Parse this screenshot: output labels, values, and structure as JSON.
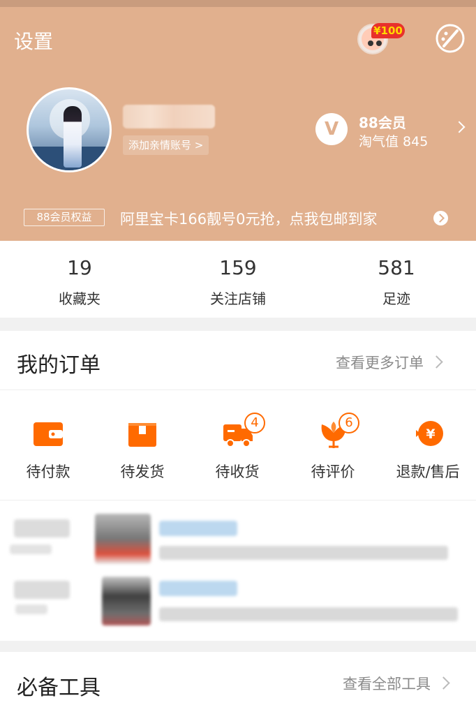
{
  "header": {
    "settings_label": "设置",
    "coin_badge": "¥100",
    "add_family_label": "添加亲情账号 >",
    "vip": {
      "title": "88会员",
      "subtitle": "淘气值 845",
      "icon_letter": "V"
    },
    "benefit_tag": "88会员权益",
    "promo_text": "阿里宝卡166靓号0元抢，点我包邮到家",
    "color_background": "#e1b08e"
  },
  "stats": [
    {
      "value": "19",
      "label": "收藏夹"
    },
    {
      "value": "159",
      "label": "关注店铺"
    },
    {
      "value": "581",
      "label": "足迹"
    }
  ],
  "orders": {
    "title": "我的订单",
    "more_label": "查看更多订单",
    "items": [
      {
        "label": "待付款",
        "icon": "wallet-icon",
        "badge": ""
      },
      {
        "label": "待发货",
        "icon": "package-icon",
        "badge": ""
      },
      {
        "label": "待收货",
        "icon": "truck-icon",
        "badge": "4"
      },
      {
        "label": "待评价",
        "icon": "review-flower-icon",
        "badge": "6"
      },
      {
        "label": "退款/售后",
        "icon": "refund-yuan-icon",
        "badge": ""
      }
    ],
    "accent_color": "#ff6a00"
  },
  "tools": {
    "title": "必备工具",
    "more_label": "查看全部工具"
  }
}
